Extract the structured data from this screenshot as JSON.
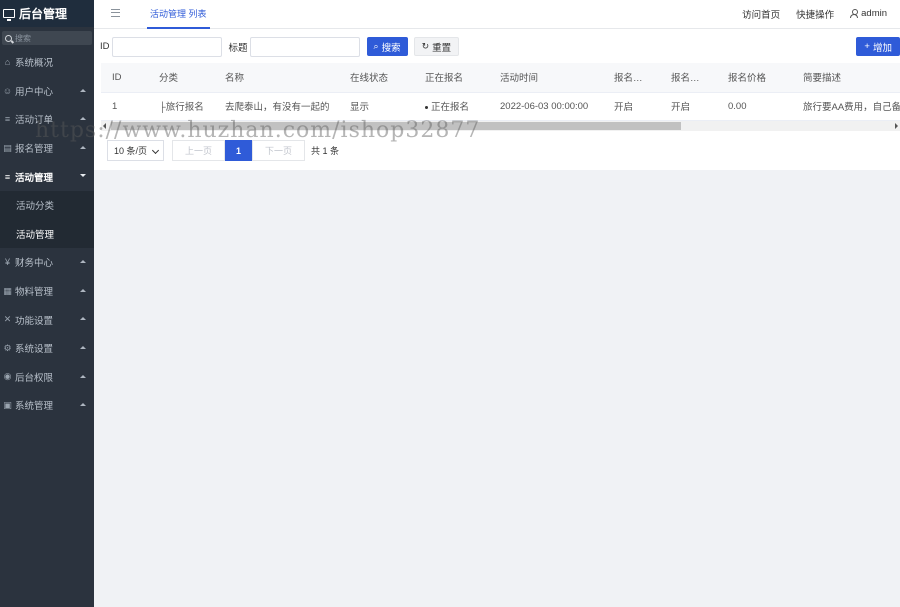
{
  "sidebar": {
    "brand": "后台管理",
    "search_placeholder": "搜索",
    "items": [
      {
        "label": "系统概况"
      },
      {
        "label": "用户中心"
      },
      {
        "label": "活动订单"
      },
      {
        "label": "报名管理"
      },
      {
        "label": "活动管理"
      },
      {
        "label": "财务中心"
      },
      {
        "label": "物料管理"
      },
      {
        "label": "功能设置"
      },
      {
        "label": "系统设置"
      },
      {
        "label": "后台权限"
      },
      {
        "label": "系统管理"
      }
    ],
    "submenu": [
      "活动分类",
      "活动管理"
    ]
  },
  "topbar": {
    "tab": "活动管理 列表",
    "links": [
      "访问首页",
      "快捷操作"
    ],
    "user": "admin"
  },
  "filters": {
    "id_label": "ID",
    "title_label": "标题",
    "search_btn": "搜索",
    "reset_btn": "重置",
    "add_btn": "增加"
  },
  "table": {
    "columns": [
      "ID",
      "分类",
      "名称",
      "在线状态",
      "正在报名",
      "活动时间",
      "报名…",
      "报名…",
      "报名价格",
      "简要描述"
    ],
    "rows": [
      [
        "1",
        "├旅行报名",
        "去爬泰山，有没有一起的",
        "显示",
        "正在报名",
        "2022-06-03 00:00:00",
        "开启",
        "开启",
        "0.00",
        "旅行要AA费用，自己备"
      ]
    ]
  },
  "pager": {
    "page_size": "10 条/页",
    "prev": "上一页",
    "current": "1",
    "next": "下一页",
    "total": "共 1 条"
  },
  "watermark": "https://www.huzhan.com/ishop32877"
}
